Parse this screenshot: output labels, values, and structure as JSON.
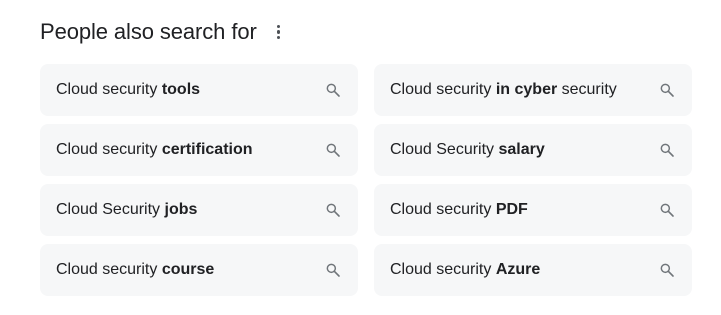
{
  "header": {
    "title": "People also search for",
    "more_icon": "more-vert-icon"
  },
  "suggestions": [
    {
      "plain": "Cloud security ",
      "bold": "tools",
      "rest": ""
    },
    {
      "plain": "Cloud security ",
      "bold": "in cyber",
      "rest": " security"
    },
    {
      "plain": "Cloud security ",
      "bold": "certification",
      "rest": ""
    },
    {
      "plain": "Cloud Security ",
      "bold": "salary",
      "rest": ""
    },
    {
      "plain": "Cloud Security ",
      "bold": "jobs",
      "rest": ""
    },
    {
      "plain": "Cloud security ",
      "bold": "PDF",
      "rest": ""
    },
    {
      "plain": "Cloud security ",
      "bold": "course",
      "rest": ""
    },
    {
      "plain": "Cloud security ",
      "bold": "Azure",
      "rest": ""
    }
  ],
  "icons": {
    "suggestion_icon": "search-icon"
  },
  "colors": {
    "chip_background": "#f6f7f8",
    "text": "#202124",
    "icon": "#70757a"
  }
}
